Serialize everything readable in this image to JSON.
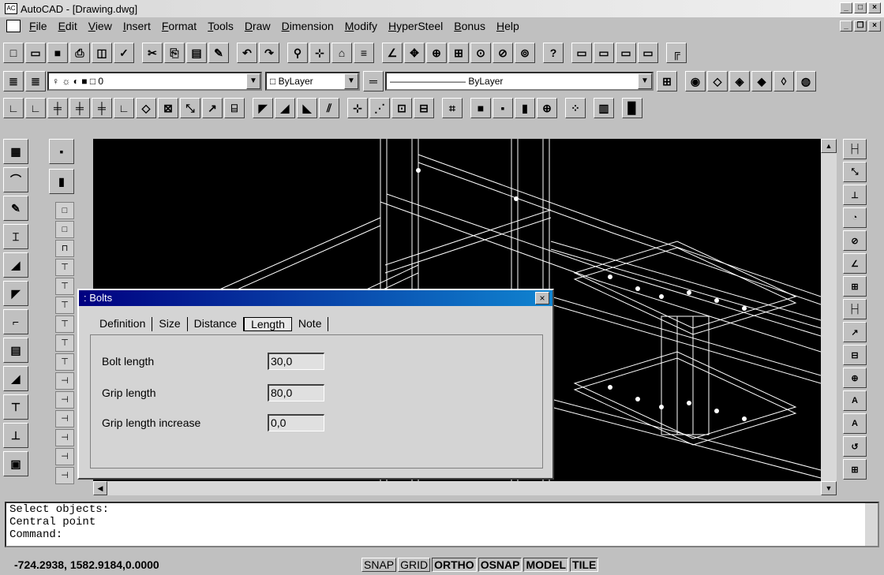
{
  "window": {
    "title": "AutoCAD - [Drawing.dwg]"
  },
  "menu": [
    "File",
    "Edit",
    "View",
    "Insert",
    "Format",
    "Tools",
    "Draw",
    "Dimension",
    "Modify",
    "HyperSteel",
    "Bonus",
    "Help"
  ],
  "properties": {
    "layer": "0",
    "color": "ByLayer",
    "linetype": "ByLayer"
  },
  "dialog": {
    "title": ": Bolts",
    "tabs": [
      "Definition",
      "Size",
      "Distance",
      "Length",
      "Note"
    ],
    "active_tab": "Length",
    "fields": [
      {
        "label": "Bolt length",
        "value": "30,0"
      },
      {
        "label": "Grip length",
        "value": "80,0"
      },
      {
        "label": "Grip length increase",
        "value": "0,0"
      }
    ],
    "close_label": "×"
  },
  "command": {
    "lines": [
      "Select objects:",
      "Central point",
      "Command:"
    ]
  },
  "status": {
    "coordinates": "-724.2938, 1582.9184,0.0000",
    "buttons": [
      "SNAP",
      "GRID",
      "ORTHO",
      "OSNAP",
      "MODEL",
      "TILE"
    ],
    "active": [
      "ORTHO",
      "OSNAP",
      "MODEL",
      "TILE"
    ]
  }
}
